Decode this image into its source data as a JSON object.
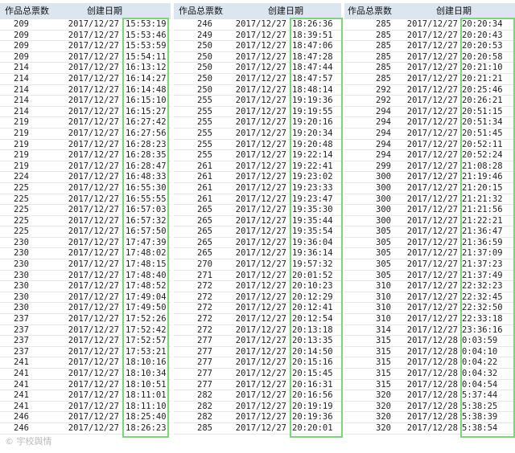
{
  "headers": {
    "votes": "作品总票数",
    "date": "创建日期"
  },
  "watermark": "© 宇校舆情",
  "highlight_color": "#7ed37e",
  "header_bg": "#dce6f1",
  "panels": [
    {
      "rows": [
        [
          "209",
          "2017/12/27",
          "15:53:19"
        ],
        [
          "209",
          "2017/12/27",
          "15:53:46"
        ],
        [
          "209",
          "2017/12/27",
          "15:53:59"
        ],
        [
          "209",
          "2017/12/27",
          "15:54:11"
        ],
        [
          "214",
          "2017/12/27",
          "16:13:12"
        ],
        [
          "214",
          "2017/12/27",
          "16:14:27"
        ],
        [
          "214",
          "2017/12/27",
          "16:14:48"
        ],
        [
          "214",
          "2017/12/27",
          "16:15:10"
        ],
        [
          "214",
          "2017/12/27",
          "16:15:27"
        ],
        [
          "219",
          "2017/12/27",
          "16:27:42"
        ],
        [
          "219",
          "2017/12/27",
          "16:27:56"
        ],
        [
          "219",
          "2017/12/27",
          "16:28:23"
        ],
        [
          "219",
          "2017/12/27",
          "16:28:35"
        ],
        [
          "219",
          "2017/12/27",
          "16:28:47"
        ],
        [
          "224",
          "2017/12/27",
          "16:48:33"
        ],
        [
          "225",
          "2017/12/27",
          "16:55:30"
        ],
        [
          "225",
          "2017/12/27",
          "16:55:55"
        ],
        [
          "225",
          "2017/12/27",
          "16:57:03"
        ],
        [
          "225",
          "2017/12/27",
          "16:57:32"
        ],
        [
          "225",
          "2017/12/27",
          "16:57:50"
        ],
        [
          "230",
          "2017/12/27",
          "17:47:39"
        ],
        [
          "230",
          "2017/12/27",
          "17:48:02"
        ],
        [
          "230",
          "2017/12/27",
          "17:48:15"
        ],
        [
          "230",
          "2017/12/27",
          "17:48:40"
        ],
        [
          "230",
          "2017/12/27",
          "17:48:52"
        ],
        [
          "230",
          "2017/12/27",
          "17:49:04"
        ],
        [
          "230",
          "2017/12/27",
          "17:49:50"
        ],
        [
          "237",
          "2017/12/27",
          "17:52:26"
        ],
        [
          "237",
          "2017/12/27",
          "17:52:42"
        ],
        [
          "237",
          "2017/12/27",
          "17:52:57"
        ],
        [
          "237",
          "2017/12/27",
          "17:53:21"
        ],
        [
          "241",
          "2017/12/27",
          "18:10:16"
        ],
        [
          "241",
          "2017/12/27",
          "18:10:34"
        ],
        [
          "241",
          "2017/12/27",
          "18:10:51"
        ],
        [
          "241",
          "2017/12/27",
          "18:11:01"
        ],
        [
          "241",
          "2017/12/27",
          "18:11:10"
        ],
        [
          "246",
          "2017/12/27",
          "18:25:40"
        ],
        [
          "246",
          "2017/12/27",
          "18:26:23"
        ]
      ]
    },
    {
      "rows": [
        [
          "246",
          "2017/12/27",
          "18:26:36"
        ],
        [
          "249",
          "2017/12/27",
          "18:39:51"
        ],
        [
          "250",
          "2017/12/27",
          "18:47:06"
        ],
        [
          "250",
          "2017/12/27",
          "18:47:28"
        ],
        [
          "250",
          "2017/12/27",
          "18:47:44"
        ],
        [
          "250",
          "2017/12/27",
          "18:47:57"
        ],
        [
          "250",
          "2017/12/27",
          "18:48:14"
        ],
        [
          "255",
          "2017/12/27",
          "19:19:36"
        ],
        [
          "255",
          "2017/12/27",
          "19:19:55"
        ],
        [
          "255",
          "2017/12/27",
          "19:20:16"
        ],
        [
          "255",
          "2017/12/27",
          "19:20:34"
        ],
        [
          "255",
          "2017/12/27",
          "19:20:48"
        ],
        [
          "255",
          "2017/12/27",
          "19:22:14"
        ],
        [
          "261",
          "2017/12/27",
          "19:22:41"
        ],
        [
          "261",
          "2017/12/27",
          "19:23:02"
        ],
        [
          "261",
          "2017/12/27",
          "19:23:33"
        ],
        [
          "261",
          "2017/12/27",
          "19:23:47"
        ],
        [
          "265",
          "2017/12/27",
          "19:35:30"
        ],
        [
          "265",
          "2017/12/27",
          "19:35:44"
        ],
        [
          "265",
          "2017/12/27",
          "19:35:54"
        ],
        [
          "265",
          "2017/12/27",
          "19:36:04"
        ],
        [
          "265",
          "2017/12/27",
          "19:36:14"
        ],
        [
          "270",
          "2017/12/27",
          "19:57:32"
        ],
        [
          "271",
          "2017/12/27",
          "20:01:52"
        ],
        [
          "272",
          "2017/12/27",
          "20:10:23"
        ],
        [
          "272",
          "2017/12/27",
          "20:12:29"
        ],
        [
          "272",
          "2017/12/27",
          "20:12:41"
        ],
        [
          "272",
          "2017/12/27",
          "20:12:54"
        ],
        [
          "272",
          "2017/12/27",
          "20:13:18"
        ],
        [
          "277",
          "2017/12/27",
          "20:13:35"
        ],
        [
          "277",
          "2017/12/27",
          "20:14:50"
        ],
        [
          "277",
          "2017/12/27",
          "20:15:16"
        ],
        [
          "277",
          "2017/12/27",
          "20:15:45"
        ],
        [
          "277",
          "2017/12/27",
          "20:16:31"
        ],
        [
          "282",
          "2017/12/27",
          "20:16:56"
        ],
        [
          "282",
          "2017/12/27",
          "20:19:19"
        ],
        [
          "282",
          "2017/12/27",
          "20:19:36"
        ],
        [
          "285",
          "2017/12/27",
          "20:20:01"
        ]
      ]
    },
    {
      "rows": [
        [
          "285",
          "2017/12/27",
          "20:20:34"
        ],
        [
          "285",
          "2017/12/27",
          "20:20:43"
        ],
        [
          "285",
          "2017/12/27",
          "20:20:53"
        ],
        [
          "285",
          "2017/12/27",
          "20:20:58"
        ],
        [
          "285",
          "2017/12/27",
          "20:21:10"
        ],
        [
          "285",
          "2017/12/27",
          "20:21:21"
        ],
        [
          "292",
          "2017/12/27",
          "20:25:46"
        ],
        [
          "292",
          "2017/12/27",
          "20:26:21"
        ],
        [
          "294",
          "2017/12/27",
          "20:51:15"
        ],
        [
          "294",
          "2017/12/27",
          "20:51:34"
        ],
        [
          "294",
          "2017/12/27",
          "20:51:45"
        ],
        [
          "294",
          "2017/12/27",
          "20:52:11"
        ],
        [
          "294",
          "2017/12/27",
          "20:52:24"
        ],
        [
          "299",
          "2017/12/27",
          "21:08:28"
        ],
        [
          "300",
          "2017/12/27",
          "21:19:46"
        ],
        [
          "300",
          "2017/12/27",
          "21:20:15"
        ],
        [
          "300",
          "2017/12/27",
          "21:21:32"
        ],
        [
          "300",
          "2017/12/27",
          "21:21:56"
        ],
        [
          "300",
          "2017/12/27",
          "21:22:21"
        ],
        [
          "305",
          "2017/12/27",
          "21:36:47"
        ],
        [
          "305",
          "2017/12/27",
          "21:36:59"
        ],
        [
          "305",
          "2017/12/27",
          "21:37:09"
        ],
        [
          "305",
          "2017/12/27",
          "21:37:23"
        ],
        [
          "305",
          "2017/12/27",
          "21:37:49"
        ],
        [
          "310",
          "2017/12/27",
          "22:32:23"
        ],
        [
          "310",
          "2017/12/27",
          "22:32:45"
        ],
        [
          "310",
          "2017/12/27",
          "22:32:50"
        ],
        [
          "310",
          "2017/12/27",
          "22:33:18"
        ],
        [
          "314",
          "2017/12/27",
          "23:36:16"
        ],
        [
          "315",
          "2017/12/28",
          "0:03:59"
        ],
        [
          "315",
          "2017/12/28",
          "0:04:10"
        ],
        [
          "315",
          "2017/12/28",
          "0:04:22"
        ],
        [
          "315",
          "2017/12/28",
          "0:04:32"
        ],
        [
          "315",
          "2017/12/28",
          "0:04:54"
        ],
        [
          "320",
          "2017/12/28",
          "5:37:44"
        ],
        [
          "320",
          "2017/12/28",
          "5:38:25"
        ],
        [
          "320",
          "2017/12/28",
          "5:38:39"
        ],
        [
          "320",
          "2017/12/28",
          "5:38:54"
        ]
      ]
    }
  ]
}
